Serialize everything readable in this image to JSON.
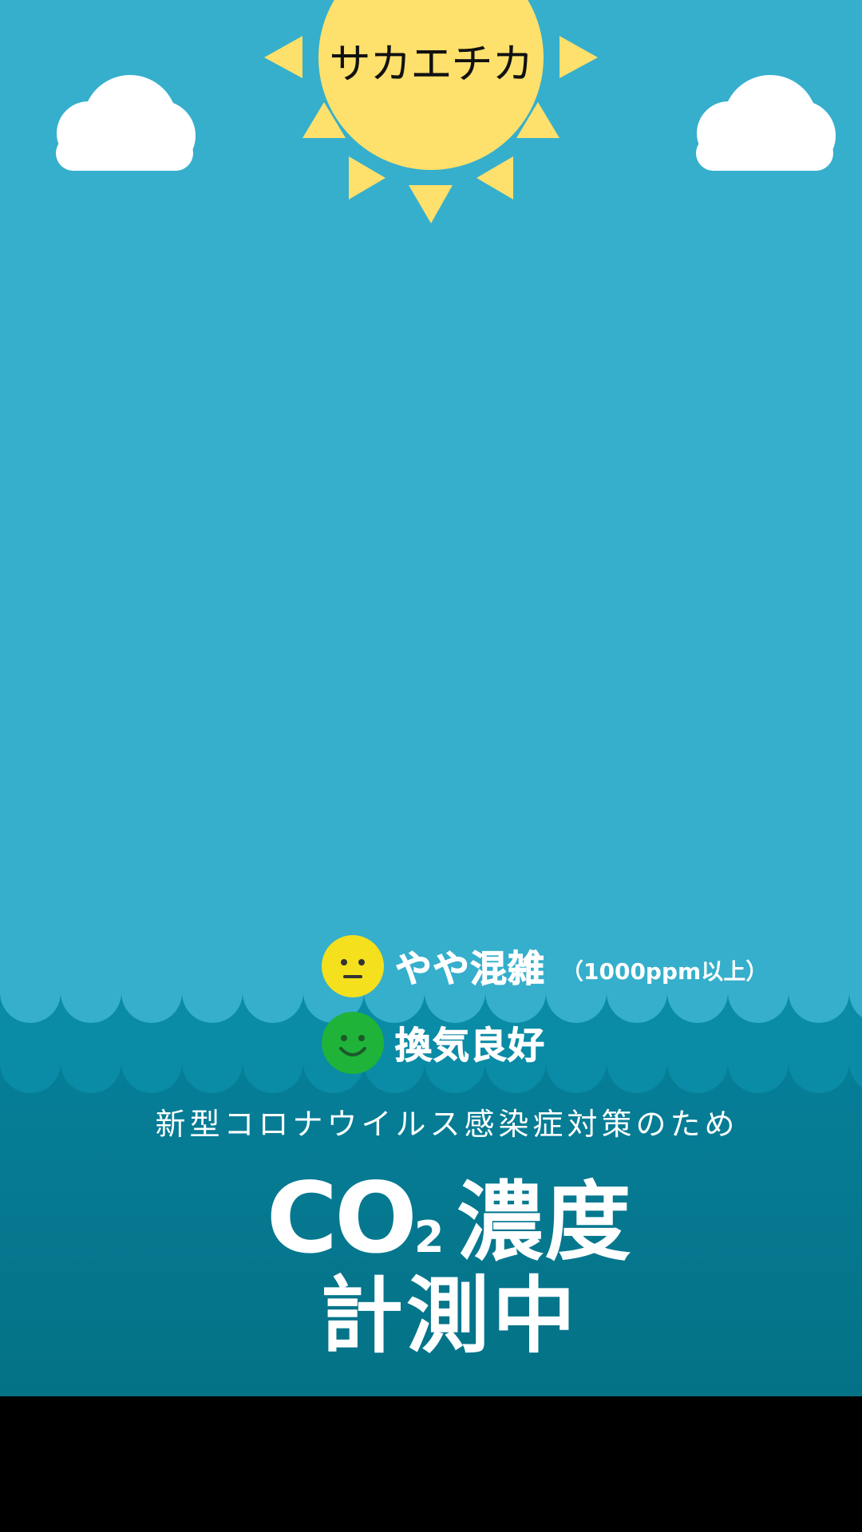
{
  "station": {
    "name": "サカエチカ"
  },
  "legend": {
    "crowded": {
      "label": "やや混雑",
      "note": "（1000ppm以上）",
      "icon": "neutral-face-icon",
      "color": "#F4E01C"
    },
    "good": {
      "label": "換気良好",
      "icon": "smiling-face-icon",
      "color": "#1FB33A"
    }
  },
  "notice": {
    "subtitle": "新型コロナウイルス感染症対策のため",
    "title_co": "CO",
    "title_sub": "2",
    "title_word": "濃度",
    "title_line2": "計測中"
  },
  "colors": {
    "sky": "#35AFCC",
    "wave_light": "#0A8BA6",
    "wave_dark": "#05728A",
    "sun": "#FEE06C"
  }
}
